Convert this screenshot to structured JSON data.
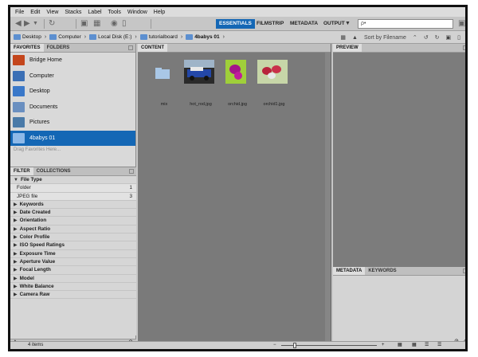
{
  "menu": [
    "File",
    "Edit",
    "View",
    "Stacks",
    "Label",
    "Tools",
    "Window",
    "Help"
  ],
  "workspaces": {
    "essentials": "ESSENTIALS",
    "filmstrip": "FILMSTRIP",
    "metadata": "METADATA",
    "output": "OUTPUT"
  },
  "search": {
    "placeholder": "ρ•"
  },
  "breadcrumb": [
    {
      "label": "Desktop"
    },
    {
      "label": "Computer"
    },
    {
      "label": "Local Disk (E:)"
    },
    {
      "label": "tutorialboard"
    },
    {
      "label": "4babys 01"
    }
  ],
  "sort_label": "Sort by Filename",
  "favorites": {
    "tabs": [
      "FAVORITES",
      "FOLDERS"
    ],
    "items": [
      {
        "label": "Bridge Home",
        "color": "#c4461c"
      },
      {
        "label": "Computer",
        "color": "#3b6fb5"
      },
      {
        "label": "Desktop",
        "color": "#3a78c9"
      },
      {
        "label": "Documents",
        "color": "#6a8fc0"
      },
      {
        "label": "Pictures",
        "color": "#4a7aa8"
      },
      {
        "label": "4babys 01",
        "color": "#8eb9e8"
      }
    ],
    "hint": "Drag Favorites Here..."
  },
  "filter": {
    "tabs": [
      "FILTER",
      "COLLECTIONS"
    ],
    "file_type": "File Type",
    "sub": [
      {
        "label": "Folder",
        "count": "1"
      },
      {
        "label": "JPEG file",
        "count": "3"
      }
    ],
    "groups": [
      "Keywords",
      "Date Created",
      "Orientation",
      "Aspect Ratio",
      "Color Profile",
      "ISO Speed Ratings",
      "Exposure Time",
      "Aperture Value",
      "Focal Length",
      "Model",
      "White Balance",
      "Camera Raw"
    ]
  },
  "content": {
    "tab": "CONTENT",
    "items": [
      {
        "name": "mix"
      },
      {
        "name": "hot_rod.jpg"
      },
      {
        "name": "orchid.jpg"
      },
      {
        "name": "orchid1.jpg"
      }
    ]
  },
  "preview": {
    "tab": "PREVIEW"
  },
  "metadata": {
    "tabs": [
      "METADATA",
      "KEYWORDS"
    ]
  },
  "status": {
    "items": "4 items"
  }
}
